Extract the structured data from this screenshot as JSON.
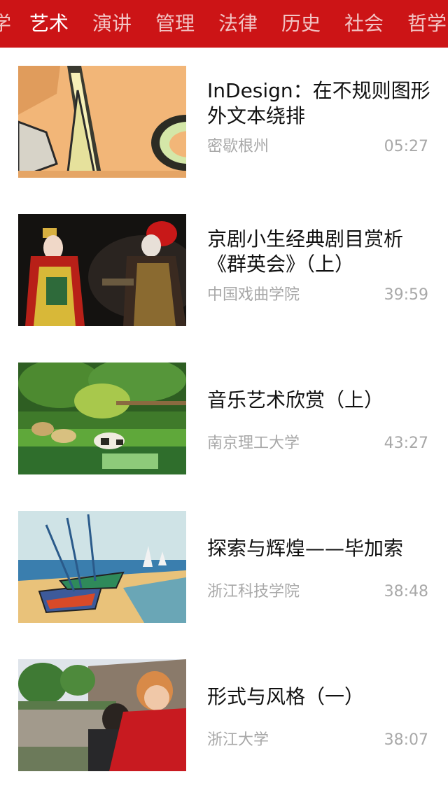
{
  "tabs": [
    {
      "label": "学",
      "active": false
    },
    {
      "label": "艺术",
      "active": true
    },
    {
      "label": "演讲",
      "active": false
    },
    {
      "label": "管理",
      "active": false
    },
    {
      "label": "法律",
      "active": false
    },
    {
      "label": "历史",
      "active": false
    },
    {
      "label": "社会",
      "active": false
    },
    {
      "label": "哲学",
      "active": false
    }
  ],
  "videos": [
    {
      "title": "InDesign：在不规则图形外文本绕排",
      "source": "密歇根州",
      "duration": "05:27"
    },
    {
      "title": "京剧小生经典剧目赏析《群英会》（上）",
      "source": "中国戏曲学院",
      "duration": "39:59"
    },
    {
      "title": "音乐艺术欣赏（上）",
      "source": "南京理工大学",
      "duration": "43:27"
    },
    {
      "title": "探索与辉煌——毕加索",
      "source": "浙江科技学院",
      "duration": "38:48"
    },
    {
      "title": "形式与风格（一）",
      "source": "浙江大学",
      "duration": "38:07"
    }
  ],
  "colors": {
    "accent": "#cc1416",
    "meta_text": "#a8a8a8"
  }
}
